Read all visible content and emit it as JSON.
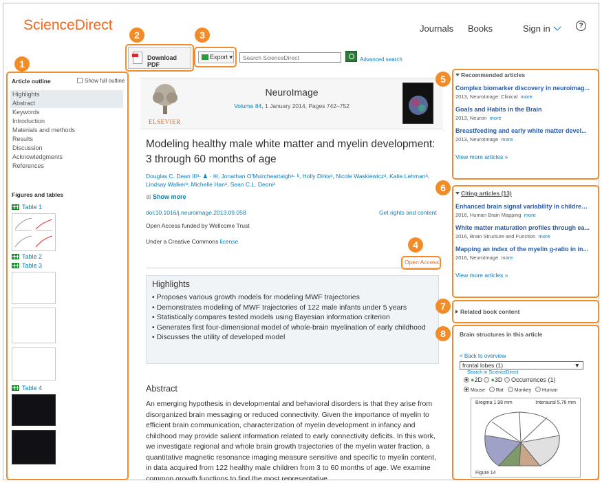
{
  "header": {
    "logo": "ScienceDirect",
    "nav": [
      "Journals",
      "Books",
      "Sign in"
    ],
    "help": "?"
  },
  "badges": [
    "1",
    "2",
    "3",
    "4",
    "5",
    "6",
    "7",
    "8"
  ],
  "toolbar": {
    "download_pdf": "Download PDF",
    "export": "Export",
    "search_placeholder": "Search ScienceDirect",
    "advanced_search": "Advanced search"
  },
  "sidebar": {
    "outline_title": "Article outline",
    "show_full_outline": "Show full outline",
    "outline_items": [
      "Highlights",
      "Abstract",
      "Keywords",
      "Introduction",
      "Materials and methods",
      "Results",
      "Discussion",
      "Acknowledgments",
      "References"
    ],
    "figures_title": "Figures and tables",
    "tables": [
      "Table 1",
      "Table 2",
      "Table 3",
      "Table 4"
    ]
  },
  "journal": {
    "publisher": "ELSEVIER",
    "name": "NeuroImage",
    "volume_link": "Volume 84",
    "volume_rest": ", 1 January 2014, Pages 742–752"
  },
  "article": {
    "title": "Modeling healthy male white matter and myelin development: 3 through 60 months of age",
    "authors": "Douglas C. Dean IIIᵃ· ♟ · ✉, Jonathan O'Muircheartaighᵃ· ᵇ, Holly Dirksᵃ, Nicole Waskiewiczᵃ, Katie Lehmanᵃ, Lindsay Walkerᵃ, Michelle Hanᵃ, Sean C.L. Deoniᵃ",
    "show_more": "Show more",
    "doi": "doi:10.1016/j.neuroimage.2013.09.058",
    "rights": "Get rights and content",
    "open_access_funded": "Open Access funded by Wellcome Trust",
    "cc_prefix": "Under a Creative Commons ",
    "cc_link": "license",
    "open_access": "Open Access",
    "highlights_title": "Highlights",
    "highlights": [
      "Proposes various growth models for modeling MWF trajectories",
      "Demonstrates modeling of MWF trajectories of 122 male infants under 5 years",
      "Statistically compares tested models using Bayesian information criterion",
      "Generates first four-dimensional model of whole-brain myelination of early childhood",
      "Discusses the utility of developed model"
    ],
    "abstract_title": "Abstract",
    "abstract": "An emerging hypothesis in developmental and behavioral disorders is that they arise from disorganized brain messaging or reduced connectivity. Given the importance of myelin to efficient brain communication, characterization of myelin development in infancy and childhood may provide salient information related to early connectivity deficits. In this work, we investigate regional and whole brain growth trajectories of the myelin water fraction, a quantitative magnetic resonance imaging measure sensitive and specific to myelin content, in data acquired from 122 healthy male children from 3 to 60 months of age. We examine common growth functions to find the most representative"
  },
  "recommended": {
    "title": "Recommended articles",
    "items": [
      {
        "title": "Complex biomarker discovery in neuroimag...",
        "meta": "2013, NeuroImage: Clinical",
        "more": "more"
      },
      {
        "title": "Goals and Habits in the Brain",
        "meta": "2013, Neuron",
        "more": "more"
      },
      {
        "title": "Breastfeeding and early white matter devel...",
        "meta": "2013, NeuroImage",
        "more": "more"
      }
    ],
    "view_more": "View more articles »"
  },
  "citing": {
    "title": "Citing articles (13)",
    "items": [
      {
        "title": "Enhanced brain signal variability in children...",
        "meta": "2016, Human Brain Mapping",
        "more": "more"
      },
      {
        "title": "White matter maturation profiles through ea...",
        "meta": "2016, Brain Structure and Function",
        "more": "more"
      },
      {
        "title": "Mapping an index of the myelin g-ratio in in...",
        "meta": "2016, NeuroImage",
        "more": "more"
      }
    ],
    "view_more": "View more articles »"
  },
  "related_book": {
    "title": "Related book content"
  },
  "brain": {
    "title": "Brain structures in this article",
    "back": "< Back to overview",
    "select_value": "frontal lobes (1)",
    "search_link": "Search in ScienceDirect",
    "view_options": [
      "2D",
      "3D",
      "Occurrences (1)"
    ],
    "species": [
      "Mouse",
      "Rat",
      "Monkey",
      "Human"
    ],
    "bregma": "Bregma 1.98 mm",
    "interaural": "Interaural 5.78 mm",
    "figure": "Figure 14"
  }
}
